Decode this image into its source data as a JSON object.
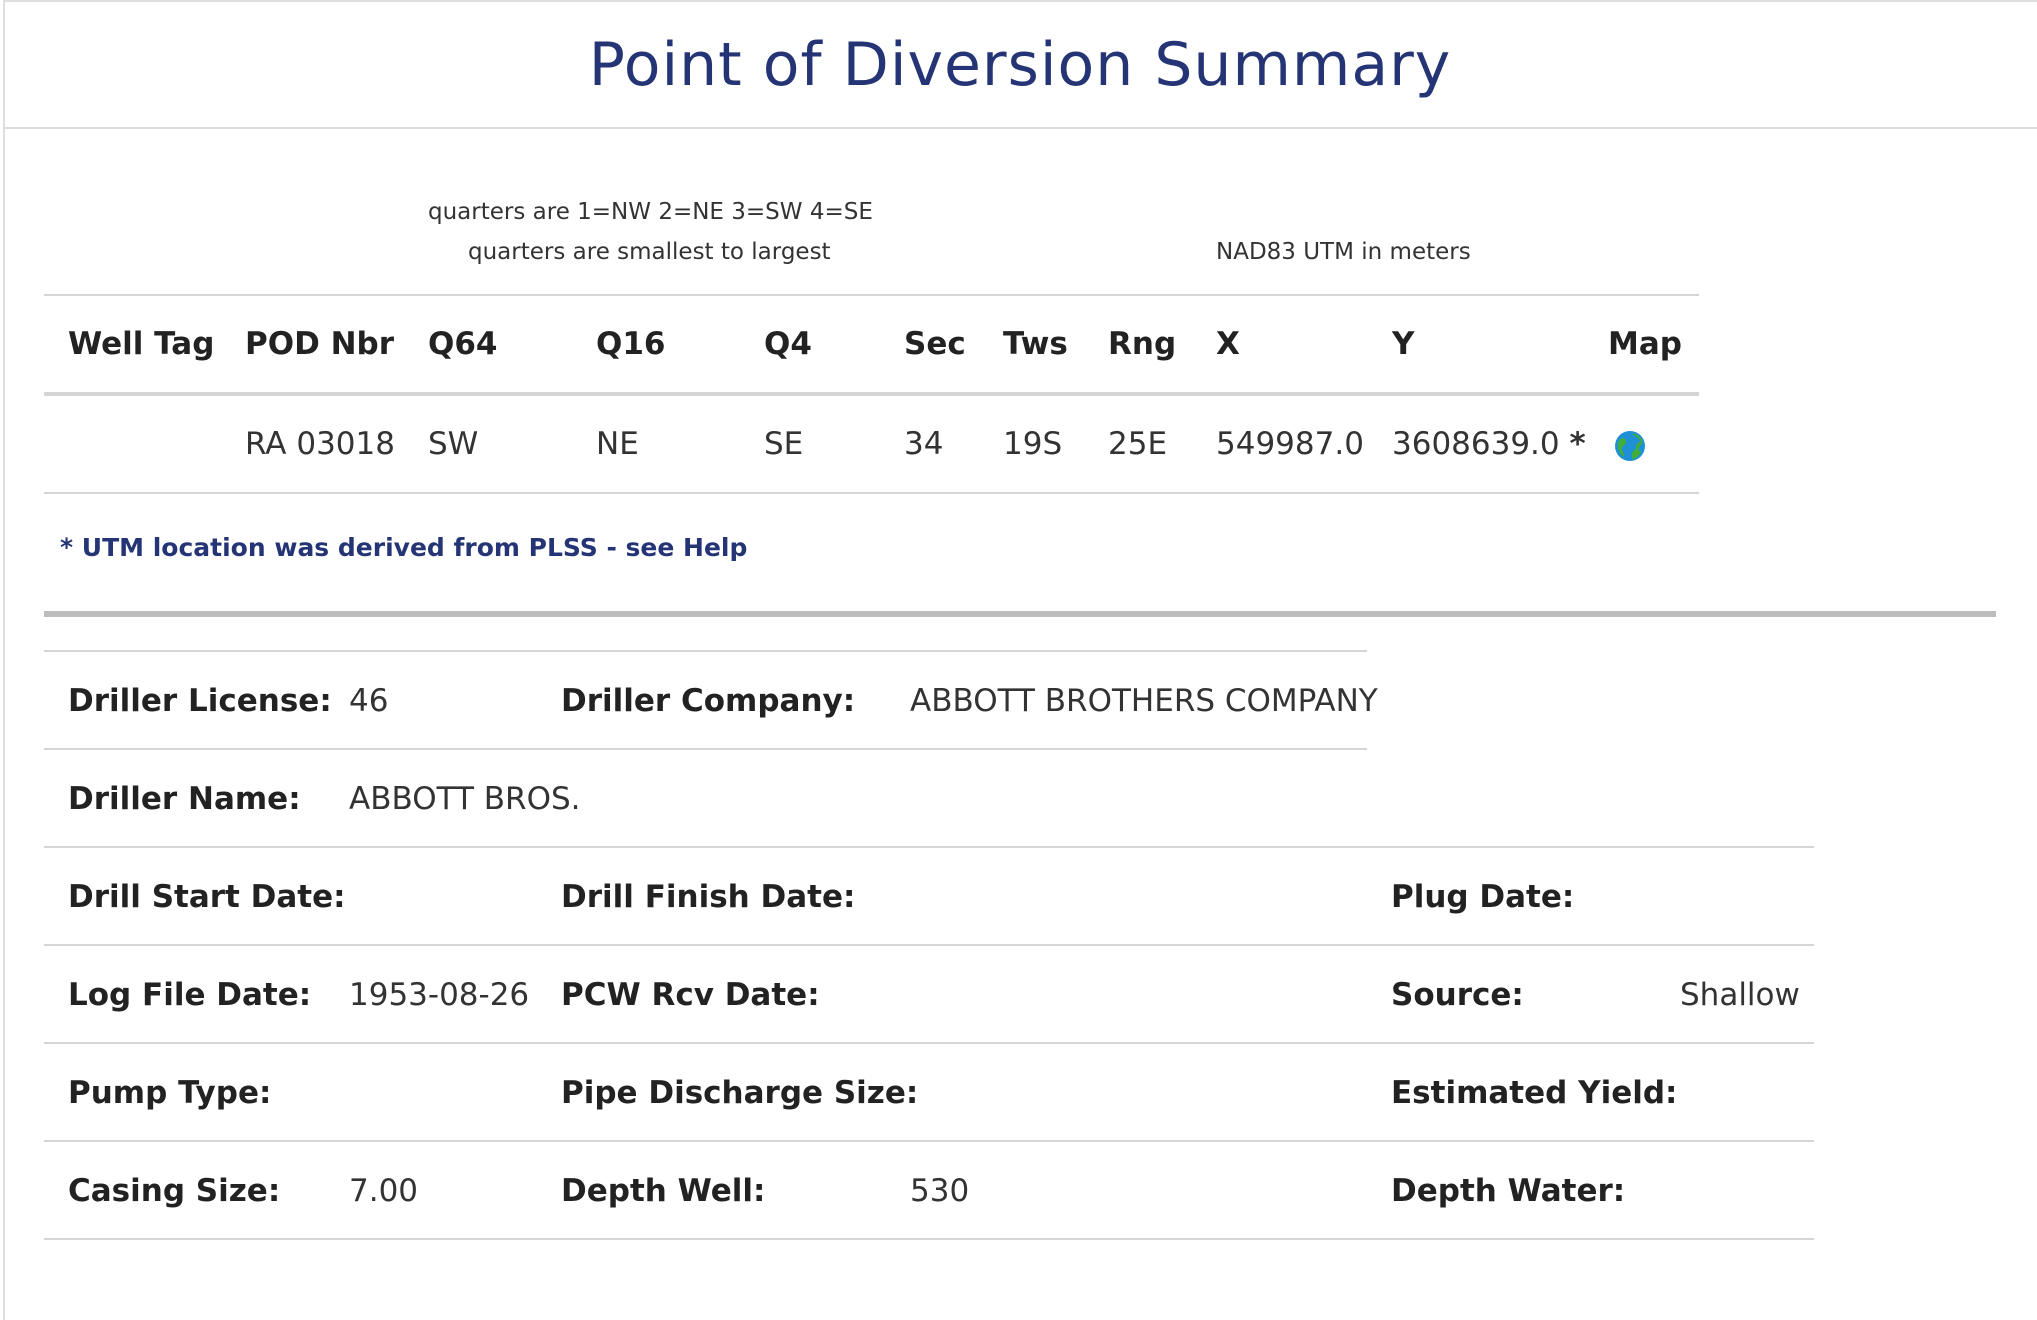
{
  "title": "Point of Diversion Summary",
  "notes": {
    "quarters_line1": "quarters are 1=NW 2=NE 3=SW 4=SE",
    "quarters_line2": "quarters are smallest to largest",
    "utm": "NAD83 UTM in meters"
  },
  "table": {
    "headers": [
      "Well Tag",
      "POD Nbr",
      "Q64",
      "Q16",
      "Q4",
      "Sec",
      "Tws",
      "Rng",
      "X",
      "Y",
      "Map"
    ],
    "row": {
      "well_tag": "",
      "pod_nbr": "RA 03018",
      "q64": "SW",
      "q16": "NE",
      "q4": "SE",
      "sec": "34",
      "tws": "19S",
      "rng": "25E",
      "x": "549987.0",
      "y": "3608639.0",
      "y_marker": "*"
    },
    "map_icon": "globe-icon"
  },
  "utm_note": "* UTM location was derived from PLSS - see Help",
  "details": {
    "driller_license_label": "Driller License:",
    "driller_license": "46",
    "driller_company_label": "Driller Company:",
    "driller_company": "ABBOTT BROTHERS COMPANY",
    "driller_name_label": "Driller Name:",
    "driller_name": "ABBOTT BROS.",
    "drill_start_label": "Drill Start Date:",
    "drill_finish_label": "Drill Finish Date:",
    "plug_date_label": "Plug Date:",
    "log_file_date_label": "Log File Date:",
    "log_file_date": "1953-08-26",
    "pcw_rcv_date_label": "PCW Rcv Date:",
    "source_label": "Source:",
    "source": "Shallow",
    "pump_type_label": "Pump Type:",
    "pipe_discharge_label": "Pipe Discharge Size:",
    "estimated_yield_label": "Estimated Yield:",
    "casing_size_label": "Casing Size:",
    "casing_size": "7.00",
    "depth_well_label": "Depth Well:",
    "depth_well": "530",
    "depth_water_label": "Depth Water:"
  },
  "colors": {
    "title": "#253475",
    "link": "#253475",
    "separator": "#bdbdbd"
  }
}
